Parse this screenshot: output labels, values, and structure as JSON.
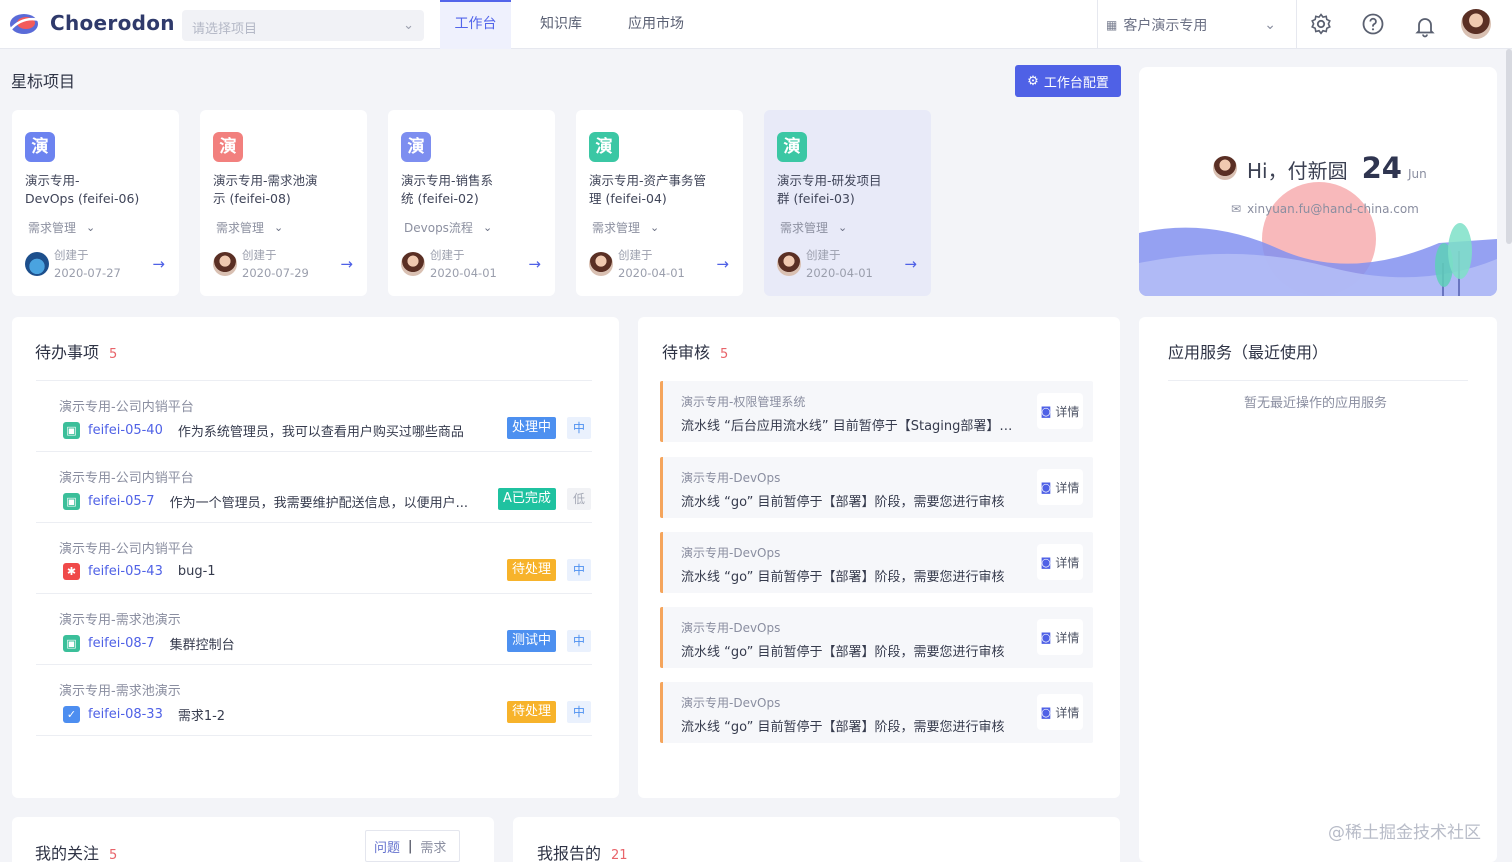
{
  "app": {
    "name": "Choerodon"
  },
  "header": {
    "project_placeholder": "请选择项目",
    "tabs": [
      "工作台",
      "知识库",
      "应用市场"
    ],
    "tenant": "客户演示专用"
  },
  "starred": {
    "title": "星标项目",
    "config_button": "工作台配置",
    "cards": [
      {
        "badge": "演",
        "badge_color": "#6c83f0",
        "name_line1": "演示专用-",
        "name_line2": "DevOps (feifei-06)",
        "type": "需求管理",
        "created_label": "创建于",
        "date": "2020-07-27"
      },
      {
        "badge": "演",
        "badge_color": "#f2807e",
        "name_line1": "演示专用-需求池演",
        "name_line2": "示 (feifei-08)",
        "type": "需求管理",
        "created_label": "创建于",
        "date": "2020-07-29"
      },
      {
        "badge": "演",
        "badge_color": "#7d8ef0",
        "name_line1": "演示专用-销售系",
        "name_line2": "统 (feifei-02)",
        "type": "Devops流程",
        "created_label": "创建于",
        "date": "2020-04-01"
      },
      {
        "badge": "演",
        "badge_color": "#3bc7a4",
        "name_line1": "演示专用-资产事务管",
        "name_line2": "理 (feifei-04)",
        "type": "需求管理",
        "created_label": "创建于",
        "date": "2020-04-01"
      },
      {
        "badge": "演",
        "badge_color": "#3bc7a4",
        "name_line1": "演示专用-研发项目",
        "name_line2": "群 (feifei-03)",
        "type": "需求管理",
        "created_label": "创建于",
        "date": "2020-04-01"
      }
    ]
  },
  "greeting": {
    "text": "Hi，付新圆",
    "day": "24",
    "month": "Jun",
    "email": "xinyuan.fu@hand-china.com"
  },
  "todo": {
    "title": "待办事项",
    "count": "5",
    "items": [
      {
        "project": "演示专用-公司内销平台",
        "icon": "story",
        "icon_color": "#3bbf9a",
        "id": "feifei-05-40",
        "desc": "作为系统管理员，我可以查看用户购买过哪些商品",
        "status": "处理中",
        "status_color": "#4d90f0",
        "priority": "中",
        "priority_color": "#4d90f0",
        "priority_bg": "#eaf1fd"
      },
      {
        "project": "演示专用-公司内销平台",
        "icon": "story",
        "icon_color": "#3bbf9a",
        "id": "feifei-05-7",
        "desc": "作为一个管理员，我需要维护配送信息，以便用户...",
        "status": "A已完成",
        "status_color": "#1fc2a0",
        "priority": "低",
        "priority_color": "#a5a9b6",
        "priority_bg": "#f1f2f5"
      },
      {
        "project": "演示专用-公司内销平台",
        "icon": "bug",
        "icon_color": "#f04a4a",
        "id": "feifei-05-43",
        "desc": "bug-1",
        "status": "待处理",
        "status_color": "#f7b32b",
        "priority": "中",
        "priority_color": "#4d90f0",
        "priority_bg": "#eaf1fd"
      },
      {
        "project": "演示专用-需求池演示",
        "icon": "story",
        "icon_color": "#3bbf9a",
        "id": "feifei-08-7",
        "desc": "集群控制台",
        "status": "测试中",
        "status_color": "#4d90f0",
        "priority": "中",
        "priority_color": "#4d90f0",
        "priority_bg": "#eaf1fd"
      },
      {
        "project": "演示专用-需求池演示",
        "icon": "task",
        "icon_color": "#4d8ef0",
        "id": "feifei-08-33",
        "desc": "需求1-2",
        "status": "待处理",
        "status_color": "#f7b32b",
        "priority": "中",
        "priority_color": "#4d90f0",
        "priority_bg": "#eaf1fd"
      }
    ]
  },
  "review": {
    "title": "待审核",
    "count": "5",
    "detail_label": "详情",
    "items": [
      {
        "project": "演示专用-权限管理系统",
        "message": "流水线 “后台应用流水线” 目前暂停于【Staging部署】阶段，需要您进行审核"
      },
      {
        "project": "演示专用-DevOps",
        "message": "流水线 “go” 目前暂停于【部署】阶段，需要您进行审核"
      },
      {
        "project": "演示专用-DevOps",
        "message": "流水线 “go” 目前暂停于【部署】阶段，需要您进行审核"
      },
      {
        "project": "演示专用-DevOps",
        "message": "流水线 “go” 目前暂停于【部署】阶段，需要您进行审核"
      },
      {
        "project": "演示专用-DevOps",
        "message": "流水线 “go” 目前暂停于【部署】阶段，需要您进行审核"
      }
    ]
  },
  "app_services": {
    "title": "应用服务（最近使用）",
    "empty": "暂无最近操作的应用服务"
  },
  "follow": {
    "title": "我的关注",
    "count": "5",
    "tab_issue": "问题",
    "tab_req": "需求"
  },
  "reported": {
    "title": "我报告的",
    "count": "21"
  },
  "watermark": "@稀土掘金技术社区"
}
